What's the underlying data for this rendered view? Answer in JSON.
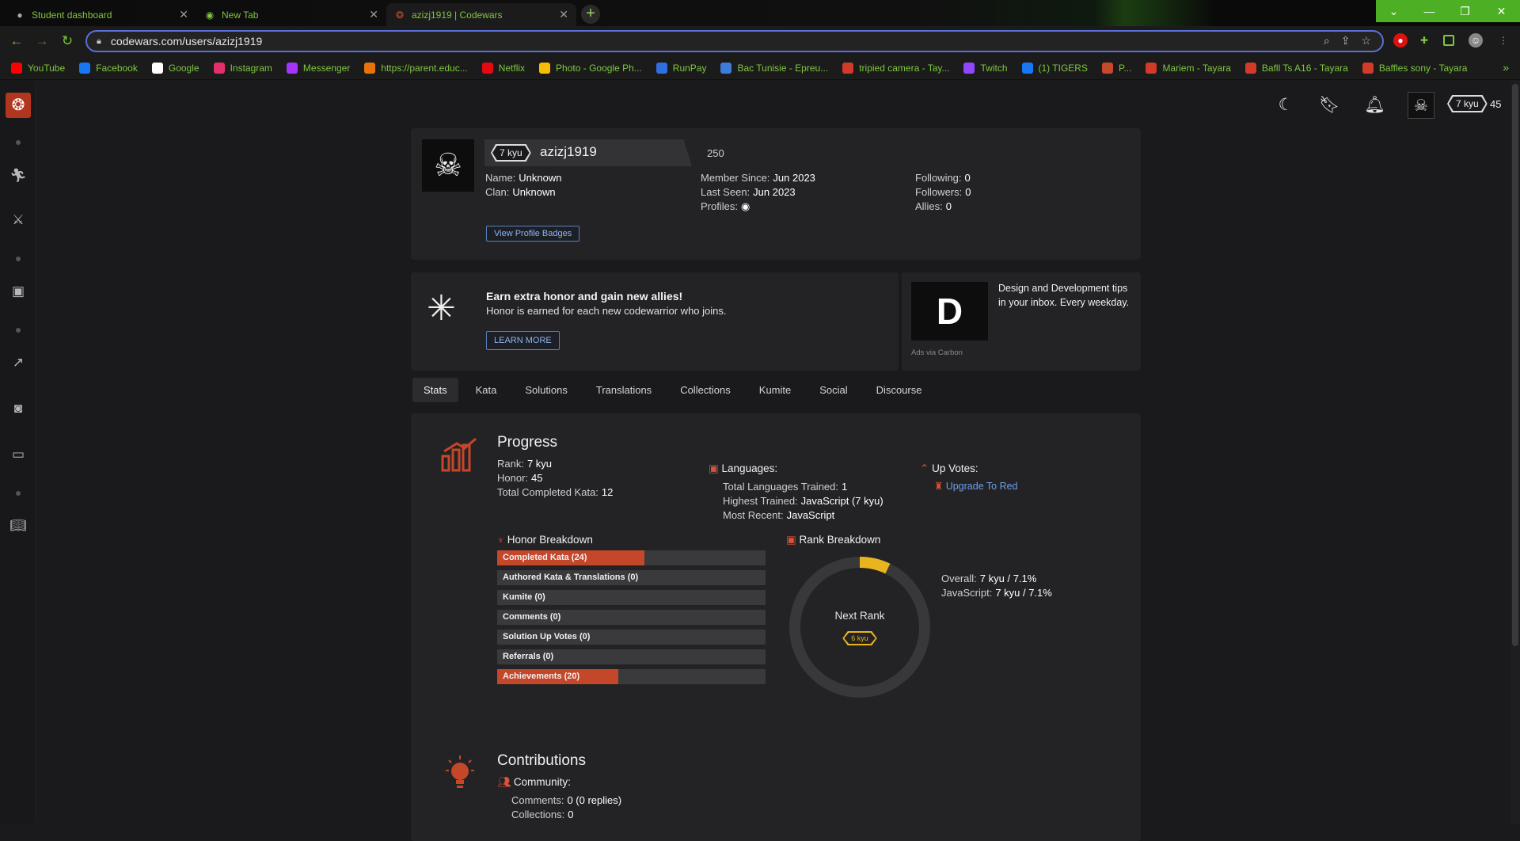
{
  "browser": {
    "tabs": [
      {
        "title": "Student dashboard",
        "icon": "globe-icon"
      },
      {
        "title": "New Tab",
        "icon": "chrome-icon"
      },
      {
        "title": "azizj1919 | Codewars",
        "icon": "codewars-icon"
      }
    ],
    "url": "codewars.com/users/azizj1919",
    "bookmarks": [
      {
        "label": "YouTube",
        "color": "#ff0000"
      },
      {
        "label": "Facebook",
        "color": "#1877f2"
      },
      {
        "label": "Google",
        "color": "#ffffff"
      },
      {
        "label": "Instagram",
        "color": "#e1306c"
      },
      {
        "label": "Messenger",
        "color": "#a334fa"
      },
      {
        "label": "https://parent.educ...",
        "color": "#e8730c"
      },
      {
        "label": "Netflix",
        "color": "#e50914"
      },
      {
        "label": "Photo - Google Ph...",
        "color": "#fbbc04"
      },
      {
        "label": "RunPay",
        "color": "#2f6fe0"
      },
      {
        "label": "Bac Tunisie - Epreu...",
        "color": "#3b7dd8"
      },
      {
        "label": "tripied camera - Tay...",
        "color": "#d23a2a"
      },
      {
        "label": "Twitch",
        "color": "#9146ff"
      },
      {
        "label": "(1) TIGERS",
        "color": "#1877f2"
      },
      {
        "label": "P...",
        "color": "#c7482a"
      },
      {
        "label": "Mariem - Tayara",
        "color": "#d23a2a"
      },
      {
        "label": "Bafll Ts A16 - Tayara",
        "color": "#d23a2a"
      },
      {
        "label": "Baffles sony - Tayara",
        "color": "#d23a2a"
      }
    ],
    "more_bookmarks": "»"
  },
  "header": {
    "rank": "7 kyu",
    "honor": "45"
  },
  "profile": {
    "rank": "7 kyu",
    "username": "azizj1919",
    "honor": "250",
    "name_label": "Name:",
    "name": "Unknown",
    "clan_label": "Clan:",
    "clan": "Unknown",
    "member_since_label": "Member Since:",
    "member_since": "Jun 2023",
    "last_seen_label": "Last Seen:",
    "last_seen": "Jun 2023",
    "profiles_label": "Profiles:",
    "following_label": "Following:",
    "following": "0",
    "followers_label": "Followers:",
    "followers": "0",
    "allies_label": "Allies:",
    "allies": "0",
    "badges_button": "View Profile Badges"
  },
  "promo": {
    "title": "Earn extra honor and gain new allies!",
    "text": "Honor is earned for each new codewarrior who joins.",
    "button": "LEARN MORE",
    "ad_text": "Design and Development tips in your inbox. Every weekday.",
    "ad_via": "Ads via Carbon"
  },
  "tabs": [
    "Stats",
    "Kata",
    "Solutions",
    "Translations",
    "Collections",
    "Kumite",
    "Social",
    "Discourse"
  ],
  "progress": {
    "title": "Progress",
    "rank_label": "Rank:",
    "rank": "7 kyu",
    "honor_label": "Honor:",
    "honor": "45",
    "kata_label": "Total Completed Kata:",
    "kata": "12",
    "languages_title": "Languages:",
    "lang_trained_label": "Total Languages Trained:",
    "lang_trained": "1",
    "highest_label": "Highest Trained:",
    "highest": "JavaScript (7 kyu)",
    "recent_label": "Most Recent:",
    "recent": "JavaScript",
    "upvotes_title": "Up Votes:",
    "upgrade_link": "Upgrade To Red"
  },
  "honor_breakdown": {
    "title": "Honor Breakdown",
    "bars": [
      {
        "label": "Completed Kata (24)",
        "fill": 0.55
      },
      {
        "label": "Authored Kata & Translations (0)",
        "fill": 0
      },
      {
        "label": "Kumite (0)",
        "fill": 0
      },
      {
        "label": "Comments (0)",
        "fill": 0
      },
      {
        "label": "Solution Up Votes (0)",
        "fill": 0
      },
      {
        "label": "Referrals (0)",
        "fill": 0
      },
      {
        "label": "Achievements (20)",
        "fill": 0.45
      }
    ]
  },
  "rank_breakdown": {
    "title": "Rank Breakdown",
    "next_rank_label": "Next Rank",
    "next_rank": "6 kyu",
    "progress": 0.071,
    "overall_label": "Overall:",
    "overall": "7 kyu / 7.1%",
    "javascript_label": "JavaScript:",
    "javascript": "7 kyu / 7.1%"
  },
  "contributions": {
    "title": "Contributions",
    "community_label": "Community:",
    "comments_label": "Comments:",
    "comments": "0 (0 replies)",
    "collections_label": "Collections:",
    "collections": "0"
  },
  "colors": {
    "accent": "#c4472a",
    "browser_accent": "#7ec63f",
    "rank_yellow": "#e9b41e"
  }
}
